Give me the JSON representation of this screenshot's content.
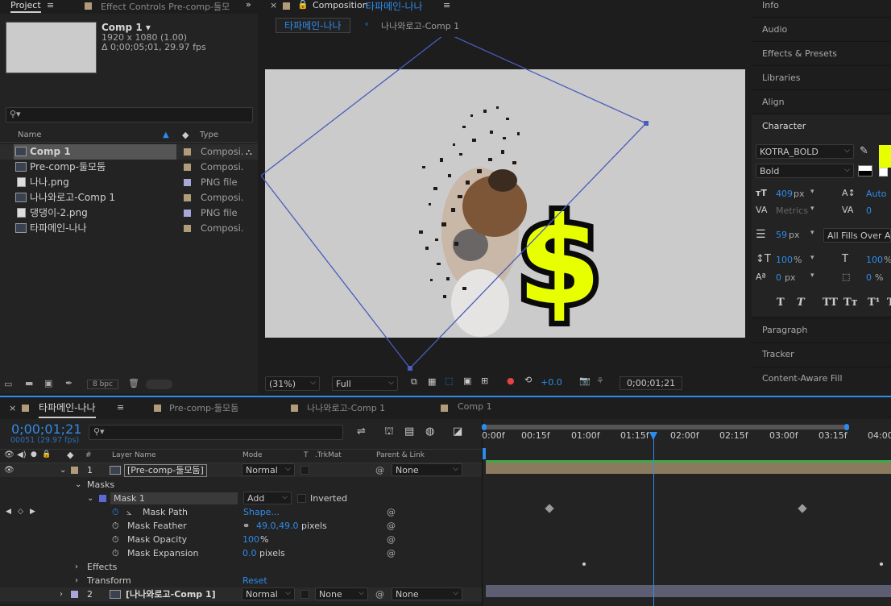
{
  "project_panel": {
    "tab_project": "Project",
    "tab_effect_controls": "Effect Controls Pre-comp-둘모",
    "selected_comp": {
      "name": "Comp 1 ▾",
      "size": "1920 x 1080 (1.00)",
      "duration": "Δ 0;00;05;01, 29.97 fps"
    },
    "search_placeholder": "",
    "columns": {
      "name": "Name",
      "type": "Type"
    },
    "items": [
      {
        "name": "Comp 1",
        "type": "Composi.",
        "label_color": "#b09b7a",
        "selected": true
      },
      {
        "name": "Pre-comp-둘모둠",
        "type": "Composi.",
        "label_color": "#b09b7a"
      },
      {
        "name": "나나.png",
        "type": "PNG file",
        "label_color": "#a8a8d8"
      },
      {
        "name": "나나와로고-Comp 1",
        "type": "Composi.",
        "label_color": "#b09b7a"
      },
      {
        "name": "댕댕이-2.png",
        "type": "PNG file",
        "label_color": "#a8a8d8"
      },
      {
        "name": "타파메인-나나",
        "type": "Composi.",
        "label_color": "#b09b7a"
      }
    ],
    "bpc": "8 bpc"
  },
  "composition_panel": {
    "tab_prefix": "Composition",
    "tab_comp_name": "타파메인-나나",
    "breadcrumb_active": "타파메인-나나",
    "breadcrumb_next": "나나와로고-Comp 1",
    "zoom": "(31%)",
    "resolution": "Full",
    "exposure": "+0.0",
    "timecode": "0;00;01;21"
  },
  "right_panel": {
    "items": [
      "Info",
      "Audio",
      "Effects & Presets",
      "Libraries",
      "Align",
      "Character"
    ],
    "character": {
      "font": "KOTRA_BOLD",
      "style": "Bold",
      "font_size": "409",
      "font_size_unit": "px",
      "leading": "Auto",
      "kerning": "Metrics",
      "tracking": "0",
      "stroke_width": "59",
      "stroke_unit": "px",
      "stroke_mode": "All Fills Over All",
      "vscale": "100",
      "hscale": "100",
      "pct": "%",
      "baseline": "0",
      "baseline_unit": "px",
      "tsume": "0",
      "tsume_unit": "%",
      "fill_color": "#e8ff00",
      "style_buttons": [
        "T",
        "T",
        "TT",
        "Tт",
        "T¹",
        "T"
      ]
    },
    "bottom_items": [
      "Paragraph",
      "Tracker",
      "Content-Aware Fill"
    ]
  },
  "timeline": {
    "tabs": [
      {
        "name": "타파메인-나나",
        "color": "#b09b7a",
        "active": true
      },
      {
        "name": "Pre-comp-둘모둠",
        "color": "#b09b7a"
      },
      {
        "name": "나나와로고-Comp 1",
        "color": "#b09b7a"
      },
      {
        "name": "Comp 1",
        "color": "#b09b7a"
      }
    ],
    "timecode": "0;00;01;21",
    "frames": "00051 (29.97 fps)",
    "columns": {
      "num": "#",
      "layer_name": "Layer Name",
      "mode": "Mode",
      "t": "T",
      "trkmat": ".TrkMat",
      "parent": "Parent & Link"
    },
    "ruler": [
      "0:00f",
      "00:15f",
      "01:00f",
      "01:15f",
      "02:00f",
      "02:15f",
      "03:00f",
      "03:15f",
      "04:00"
    ],
    "layer1": {
      "num": "1",
      "name": "[Pre-comp-둘모둠]",
      "mode": "Normal",
      "parent": "None"
    },
    "masks_label": "Masks",
    "mask1": {
      "name": "Mask 1",
      "mode": "Add",
      "inverted": "Inverted"
    },
    "mask_props": [
      {
        "name": "Mask Path",
        "value": "Shape...",
        "unit": ""
      },
      {
        "name": "Mask Feather",
        "value": "49.0,49.0",
        "unit": "pixels"
      },
      {
        "name": "Mask Opacity",
        "value": "100",
        "unit": "%"
      },
      {
        "name": "Mask Expansion",
        "value": "0.0",
        "unit": "pixels"
      }
    ],
    "effects_label": "Effects",
    "transform_label": "Transform",
    "reset_label": "Reset",
    "layer2": {
      "num": "2",
      "name": "[나나와로고-Comp 1]",
      "mode": "Normal",
      "trkmat": "None",
      "parent": "None"
    }
  }
}
